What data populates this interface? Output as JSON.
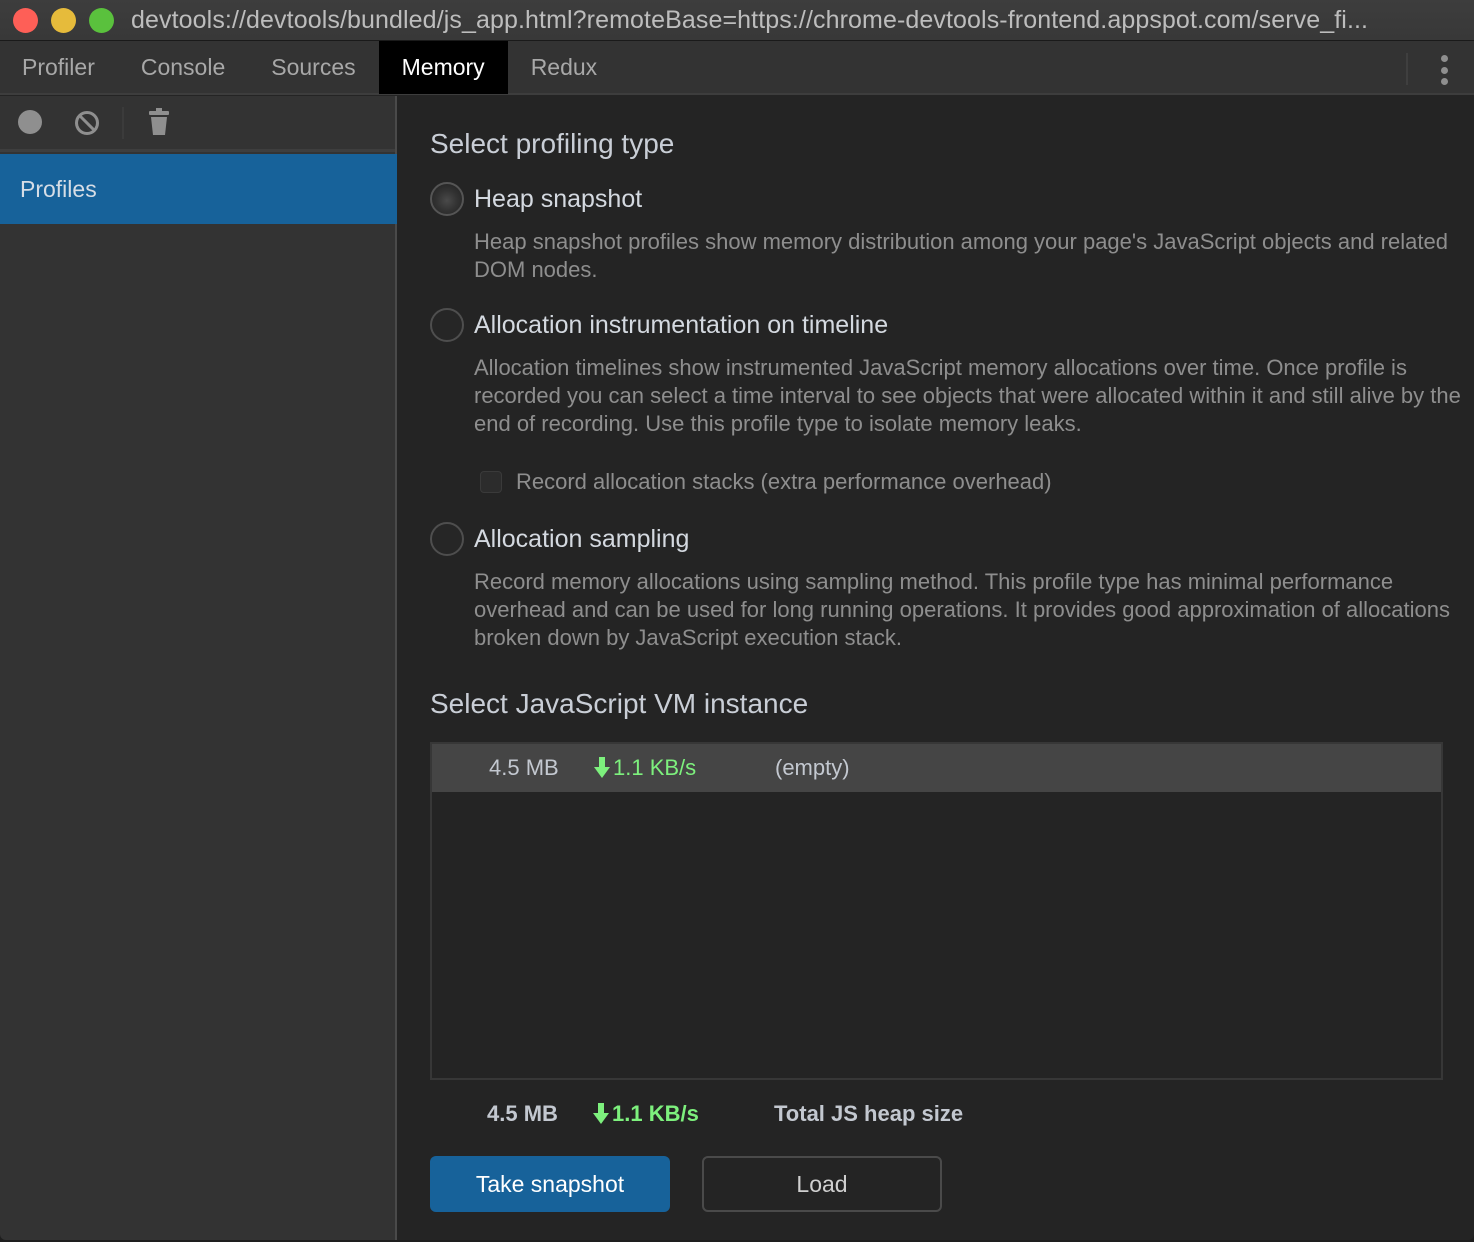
{
  "window": {
    "title": "devtools://devtools/bundled/js_app.html?remoteBase=https://chrome-devtools-frontend.appspot.com/serve_fi..."
  },
  "tabs": [
    {
      "label": "Profiler",
      "active": false
    },
    {
      "label": "Console",
      "active": false
    },
    {
      "label": "Sources",
      "active": false
    },
    {
      "label": "Memory",
      "active": true
    },
    {
      "label": "Redux",
      "active": false
    }
  ],
  "sidebar": {
    "toolbar": {
      "icons": [
        "record-icon",
        "clear-icon",
        "trash-icon"
      ]
    },
    "items": [
      {
        "label": "Profiles",
        "selected": true
      }
    ]
  },
  "main": {
    "profiling_title": "Select profiling type",
    "profiling_types": [
      {
        "label": "Heap snapshot",
        "description": "Heap snapshot profiles show memory distribution among your page's JavaScript objects and related DOM nodes.",
        "selected": false
      },
      {
        "label": "Allocation instrumentation on timeline",
        "description": "Allocation timelines show instrumented JavaScript memory allocations over time. Once profile is recorded you can select a time interval to see objects that were allocated within it and still alive by the end of recording. Use this profile type to isolate memory leaks.",
        "selected": false,
        "option": {
          "label": "Record allocation stacks (extra performance overhead)",
          "checked": false
        }
      },
      {
        "label": "Allocation sampling",
        "description": "Record memory allocations using sampling method. This profile type has minimal performance overhead and can be used for long running operations. It provides good approximation of allocations broken down by JavaScript execution stack.",
        "selected": false
      }
    ],
    "vm_title": "Select JavaScript VM instance",
    "vm_instances": [
      {
        "size": "4.5 MB",
        "rate": "1.1 KB/s",
        "name": "(empty)"
      }
    ],
    "total": {
      "size": "4.5 MB",
      "rate": "1.1 KB/s",
      "label": "Total JS heap size"
    },
    "buttons": {
      "take_snapshot": "Take snapshot",
      "load": "Load"
    }
  },
  "colors": {
    "accent": "#17629a",
    "rate_green": "#7df07d",
    "background": "#242424",
    "sidebar": "#333333"
  }
}
